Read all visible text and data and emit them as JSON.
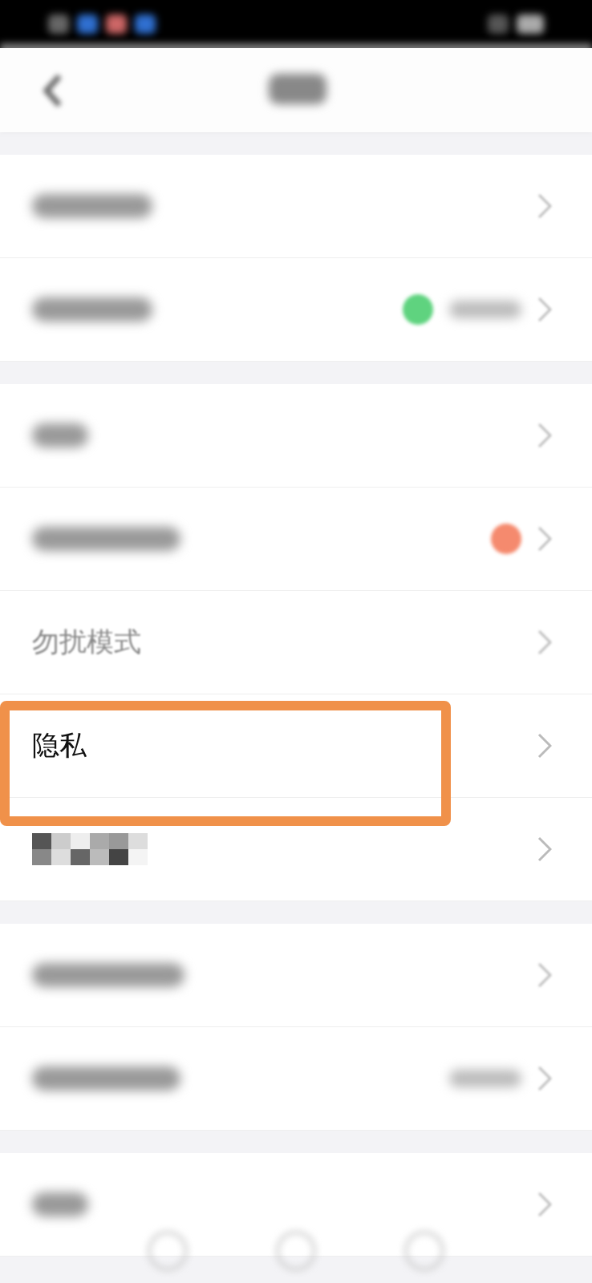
{
  "sections": [
    {
      "rows": [
        {
          "kind": "blurred",
          "highlighted": false
        },
        {
          "kind": "blurred",
          "highlighted": false,
          "status_dot": {
            "color": "#5fd37f"
          },
          "has_value": true
        }
      ]
    },
    {
      "rows": [
        {
          "kind": "blurred",
          "highlighted": false
        },
        {
          "kind": "blurred",
          "highlighted": false,
          "status_dot": {
            "color": "#f58a6e"
          }
        },
        {
          "kind": "faded",
          "label": "勿扰模式",
          "highlighted": false
        },
        {
          "kind": "text",
          "label": "隐私",
          "highlighted": true
        },
        {
          "kind": "pixelated",
          "highlighted": false
        }
      ]
    },
    {
      "rows": [
        {
          "kind": "blurred",
          "highlighted": false
        },
        {
          "kind": "blurred",
          "highlighted": false,
          "has_value": true
        }
      ]
    },
    {
      "rows": [
        {
          "kind": "blurred",
          "highlighted": false
        }
      ]
    }
  ]
}
